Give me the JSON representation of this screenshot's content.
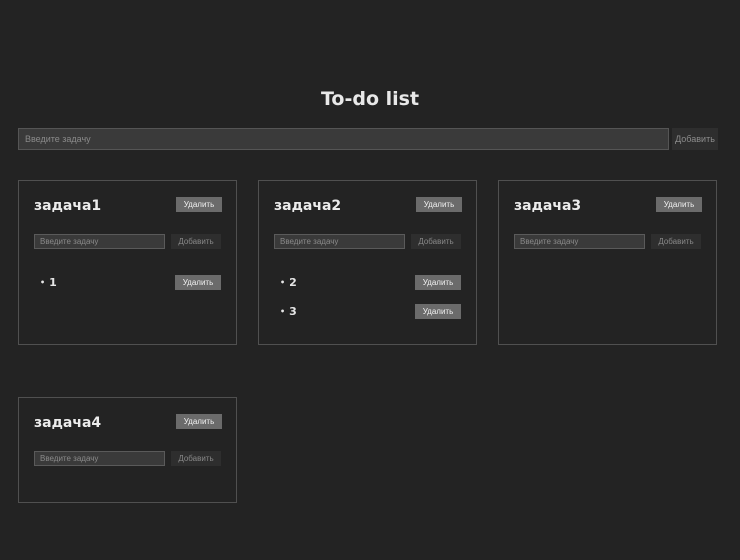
{
  "app": {
    "title": "To-do list"
  },
  "new_list": {
    "placeholder": "Введите задачу",
    "add_label": "Добавить"
  },
  "lists": [
    {
      "title": "задача1",
      "delete_label": "Удалить",
      "input_placeholder": "Введите задачу",
      "add_label": "Добавить",
      "items": [
        {
          "text": "1",
          "delete_label": "Удалить"
        }
      ]
    },
    {
      "title": "задача2",
      "delete_label": "Удалить",
      "input_placeholder": "Введите задачу",
      "add_label": "Добавить",
      "items": [
        {
          "text": "2",
          "delete_label": "Удалить"
        },
        {
          "text": "3",
          "delete_label": "Удалить"
        }
      ]
    },
    {
      "title": "задача3",
      "delete_label": "Удалить",
      "input_placeholder": "Введите задачу",
      "add_label": "Добавить",
      "items": []
    },
    {
      "title": "задача4",
      "delete_label": "Удалить",
      "input_placeholder": "Введите задачу",
      "add_label": "Добавить",
      "items": []
    }
  ]
}
